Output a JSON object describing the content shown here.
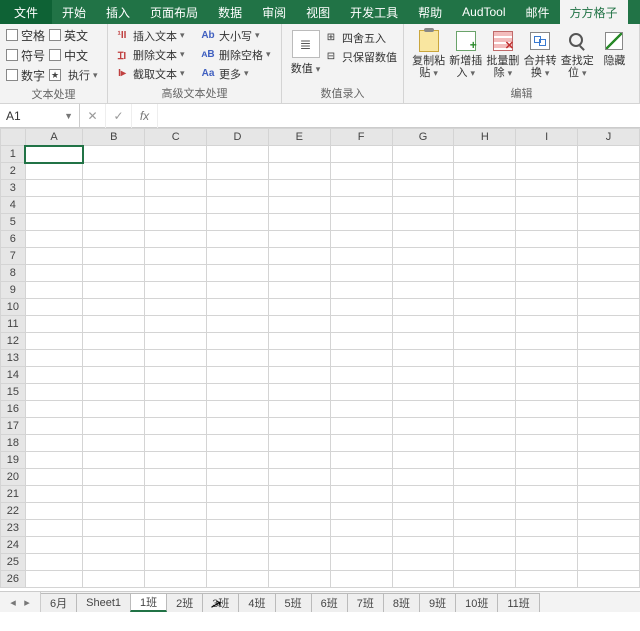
{
  "tabs": {
    "app": "文件",
    "items": [
      "开始",
      "插入",
      "页面布局",
      "数据",
      "审阅",
      "视图",
      "开发工具",
      "帮助",
      "AudTool",
      "邮件",
      "方方格子"
    ],
    "activeIndex": 10
  },
  "ribbon": {
    "textproc": {
      "label": "文本处理",
      "opts": {
        "space": "空格",
        "english": "英文",
        "symbol": "符号",
        "chinese": "中文",
        "number": "数字"
      },
      "exec": "执行"
    },
    "advtext": {
      "label": "高级文本处理",
      "insert": "插入文本",
      "delete": "删除文本",
      "extract": "截取文本",
      "bigsmall": "大小写",
      "delspace": "删除空格",
      "more": "更多"
    },
    "numentry": {
      "label": "数值录入",
      "big": "数值",
      "round": "四舍五入",
      "keepnum": "只保留数值"
    },
    "edit": {
      "label": "编辑",
      "paste": "复制粘贴",
      "insert": "新增插入",
      "batchdel": "批量删除",
      "merge": "合并转换",
      "find": "查找定位",
      "hide": "隐藏"
    }
  },
  "formula_bar": {
    "cell_ref": "A1",
    "formula": ""
  },
  "grid": {
    "columns": [
      "A",
      "B",
      "C",
      "D",
      "E",
      "F",
      "G",
      "H",
      "I",
      "J"
    ],
    "rows": [
      1,
      2,
      3,
      4,
      5,
      6,
      7,
      8,
      9,
      10,
      11,
      12,
      13,
      14,
      15,
      16,
      17,
      18,
      19,
      20,
      21,
      22,
      23,
      24,
      25,
      26
    ],
    "selected": "A1"
  },
  "sheet_tabs": {
    "items": [
      "6月",
      "Sheet1",
      "1班",
      "2班",
      "3班",
      "4班",
      "5班",
      "6班",
      "7班",
      "8班",
      "9班",
      "10班",
      "11班"
    ],
    "activeIndex": 2
  }
}
